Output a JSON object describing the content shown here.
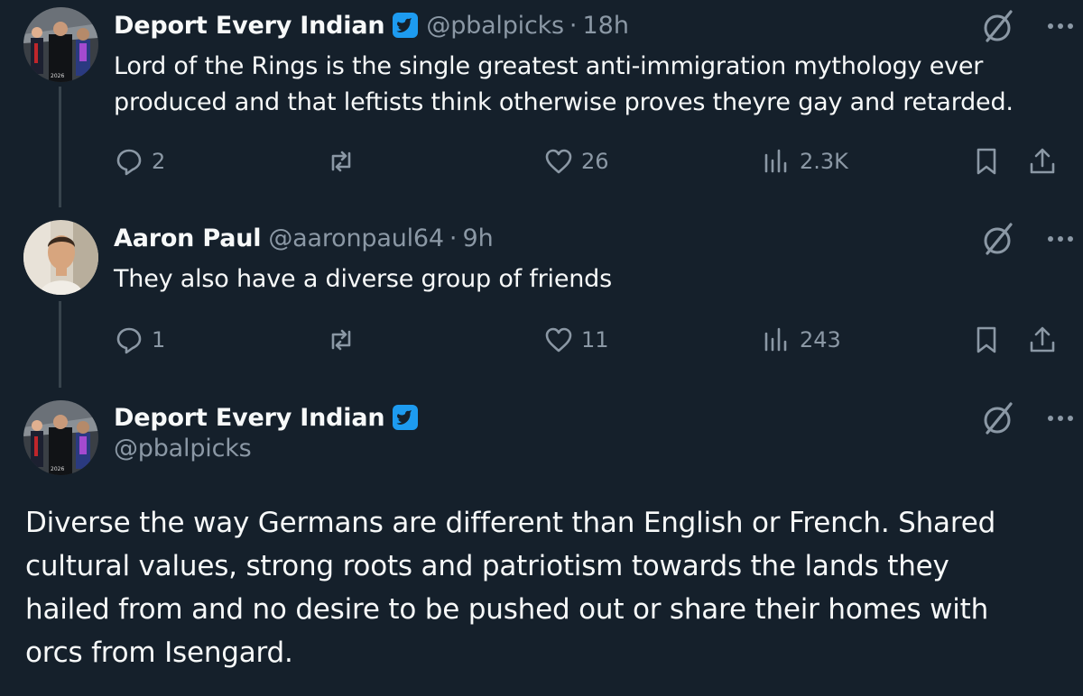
{
  "tweets": [
    {
      "author_name": "Deport Every Indian",
      "handle": "@pbalpicks",
      "separator": "·",
      "time": "18h",
      "lines": [
        "Lord of the Rings is the single greatest anti-immigration mythology ever",
        "produced and that leftists think otherwise proves theyre gay and retarded."
      ],
      "replies": "2",
      "reposts": "",
      "likes": "26",
      "views": "2.3K"
    },
    {
      "author_name": "Aaron Paul",
      "handle": "@aaronpaul64",
      "separator": "·",
      "time": "9h",
      "lines": [
        "They also have a diverse group of friends"
      ],
      "replies": "1",
      "reposts": "",
      "likes": "11",
      "views": "243"
    }
  ],
  "main_tweet": {
    "author_name": "Deport Every Indian",
    "handle": "@pbalpicks",
    "lines": [
      "Diverse the way Germans are different than English or French. Shared",
      "cultural values, strong roots and patriotism towards the lands they",
      "hailed from and no desire to be pushed out or share their homes with",
      "orcs from Isengard."
    ]
  },
  "icons": {
    "reply": "reply-bubble-icon",
    "repost": "repost-icon",
    "like": "heart-icon",
    "views": "views-bar-chart-icon",
    "bookmark": "bookmark-icon",
    "share": "share-upload-icon",
    "grok": "grok-icon",
    "more": "more-dots-icon",
    "verified": "verified-badge-icon"
  },
  "colors": {
    "background": "#15202b",
    "text": "#f7f9f9",
    "secondary": "#8b98a5",
    "verified": "#1d9bf0",
    "thread_line": "#38444d"
  }
}
